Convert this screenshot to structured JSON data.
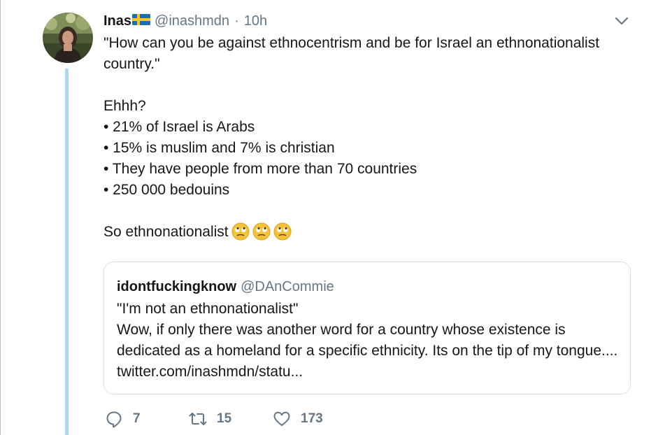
{
  "tweet": {
    "name": "Inas",
    "flag_icon": "sweden-flag-icon",
    "handle": "@inashmdn",
    "separator": "·",
    "time": "10h",
    "lines": [
      "\"How can you be against ethnocentrism and be for Israel an ethnonationalist country.\"",
      "",
      "Ehhh?",
      "• 21% of Israel is Arabs",
      "• 15% is muslim and 7% is christian",
      "• They have people from more than 70 countries",
      "• 250 000 bedouins",
      "",
      "So ethnonationalist"
    ],
    "emoji_icon": "face-with-rolling-eyes-icon",
    "emoji_count": 3
  },
  "quoted": {
    "name": "idontfuckingknow",
    "handle": "@DAnCommie",
    "line1": "\"I'm not an ethnonationalist\"",
    "line2": "Wow, if only there was another word for a country whose existence is dedicated as a homeland for a specific ethnicity. Its on the tip of my tongue.... twitter.com/inashmdn/statu..."
  },
  "actions": {
    "reply_count": "7",
    "retweet_count": "15",
    "like_count": "173"
  },
  "colors": {
    "thread_line": "#a9d7f4",
    "muted_text": "#657786",
    "primary_text": "#14171a",
    "border": "#d9e0e5"
  }
}
